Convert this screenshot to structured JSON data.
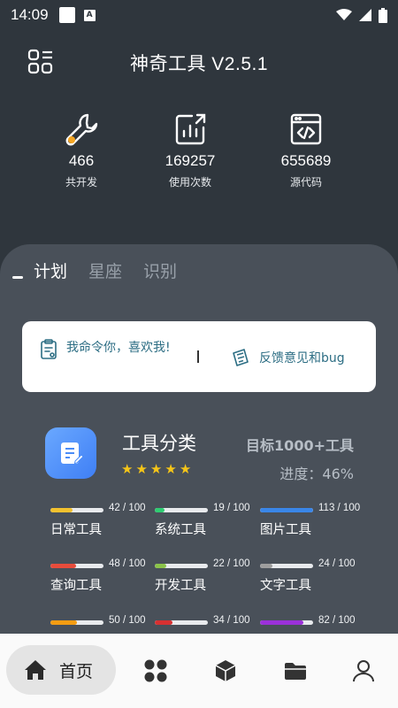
{
  "status_bar": {
    "time": "14:09"
  },
  "header": {
    "title": "神奇工具 V2.5.1"
  },
  "stats": [
    {
      "value": "466",
      "label": "共开发",
      "icon": "wrench-icon"
    },
    {
      "value": "169257",
      "label": "使用次数",
      "icon": "chart-icon"
    },
    {
      "value": "655689",
      "label": "源代码",
      "icon": "code-icon"
    }
  ],
  "tabs": [
    "计划",
    "星座",
    "识别"
  ],
  "card": {
    "left_text": "我命令你，喜欢我!",
    "right_text": "反馈意见和bug"
  },
  "category": {
    "title": "工具分类",
    "rating": 5,
    "goal": "目标1000+工具",
    "progress": "进度：46%"
  },
  "tools": [
    {
      "name": "日常工具",
      "count": "42 / 100",
      "value": 42,
      "color": "#f2c12e"
    },
    {
      "name": "系统工具",
      "count": "19 / 100",
      "value": 19,
      "color": "#2ecc71"
    },
    {
      "name": "图片工具",
      "count": "113 / 100",
      "value": 100,
      "color": "#3a86e8"
    },
    {
      "name": "查询工具",
      "count": "48 / 100",
      "value": 48,
      "color": "#e74c3c"
    },
    {
      "name": "开发工具",
      "count": "22 / 100",
      "value": 22,
      "color": "#8bc34a"
    },
    {
      "name": "文字工具",
      "count": "24 / 100",
      "value": 24,
      "color": "#9e9e9e"
    },
    {
      "name": "",
      "count": "50 / 100",
      "value": 50,
      "color": "#f39c12"
    },
    {
      "name": "",
      "count": "34 / 100",
      "value": 34,
      "color": "#d63031"
    },
    {
      "name": "",
      "count": "82 / 100",
      "value": 82,
      "color": "#9b30d9"
    }
  ],
  "bottom_nav": {
    "home_label": "首页"
  }
}
